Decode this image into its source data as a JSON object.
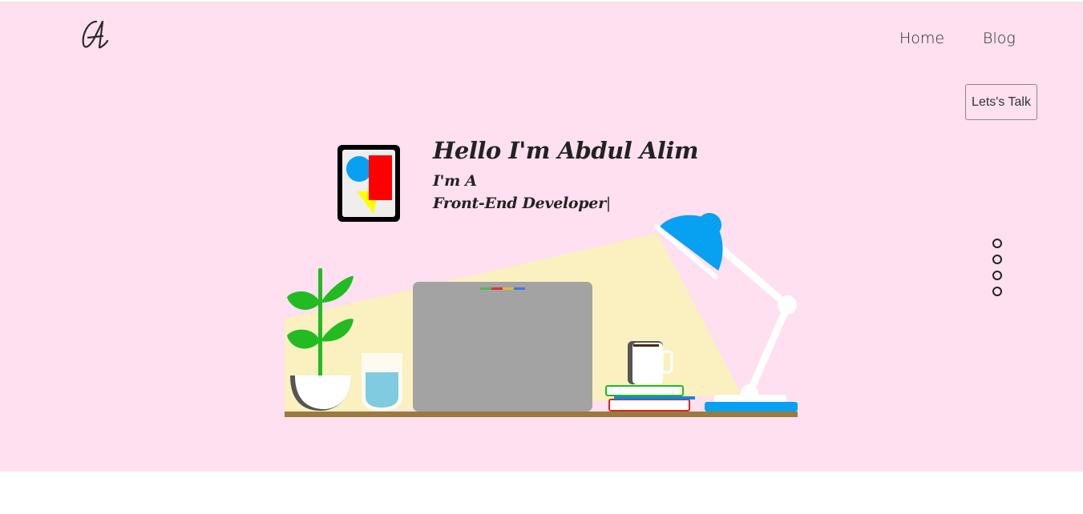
{
  "nav": {
    "logo_label": "A",
    "items": [
      {
        "label": "Home"
      },
      {
        "label": "Blog"
      }
    ]
  },
  "cta": {
    "label": "Lets's Talk"
  },
  "hero": {
    "title": "Hello I'm Abdul Alim",
    "line1": "I'm A",
    "line2": "Front-End Developer",
    "cursor": "|"
  },
  "slider": {
    "dot_count": 4
  },
  "colors": {
    "hero_bg": "#ffe0f0",
    "lamp_blue": "#08a0f0",
    "plant_green": "#22bb22",
    "laptop_gray": "#a3a3a3",
    "light_beam": "#fbf0c0",
    "shelf_brown": "#9c7a3c"
  }
}
